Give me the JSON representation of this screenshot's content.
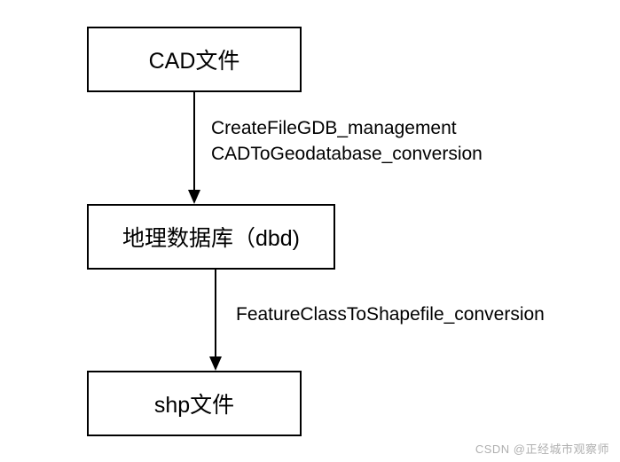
{
  "chart_data": {
    "type": "diagram",
    "nodes": [
      {
        "id": "cad",
        "label": "CAD文件"
      },
      {
        "id": "gdb",
        "label": "地理数据库（dbd)"
      },
      {
        "id": "shp",
        "label": "shp文件"
      }
    ],
    "edges": [
      {
        "from": "cad",
        "to": "gdb",
        "labels": [
          "CreateFileGDB_management",
          "CADToGeodatabase_conversion"
        ]
      },
      {
        "from": "gdb",
        "to": "shp",
        "labels": [
          "FeatureClassToShapefile_conversion"
        ]
      }
    ]
  },
  "nodes": {
    "cad": "CAD文件",
    "gdb": "地理数据库（dbd)",
    "shp": "shp文件"
  },
  "edges": {
    "e1_line1": "CreateFileGDB_management",
    "e1_line2": "CADToGeodatabase_conversion",
    "e2_line1": "FeatureClassToShapefile_conversion"
  },
  "watermark": "CSDN @正经城市观察师"
}
